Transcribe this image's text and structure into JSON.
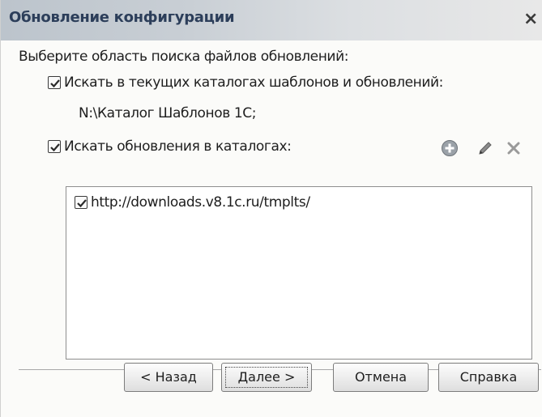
{
  "dialog": {
    "title": "Обновление конфигурации",
    "close_glyph": "×"
  },
  "main": {
    "prompt": "Выберите область поиска файлов обновлений:",
    "search_current": {
      "label": "Искать в текущих каталогах шаблонов и обновлений:",
      "checked": true,
      "path": "N:\\Каталог Шаблонов 1С;"
    },
    "search_dirs": {
      "label": "Искать обновления в каталогах:",
      "checked": true
    },
    "toolbar": {
      "icons": [
        "add-icon",
        "edit-icon",
        "delete-icon"
      ]
    },
    "directories": [
      {
        "url": "http://downloads.v8.1c.ru/tmplts/",
        "checked": true
      }
    ]
  },
  "buttons": {
    "back": "< Назад",
    "next": "Далее >",
    "cancel": "Отмена",
    "help": "Справка"
  }
}
